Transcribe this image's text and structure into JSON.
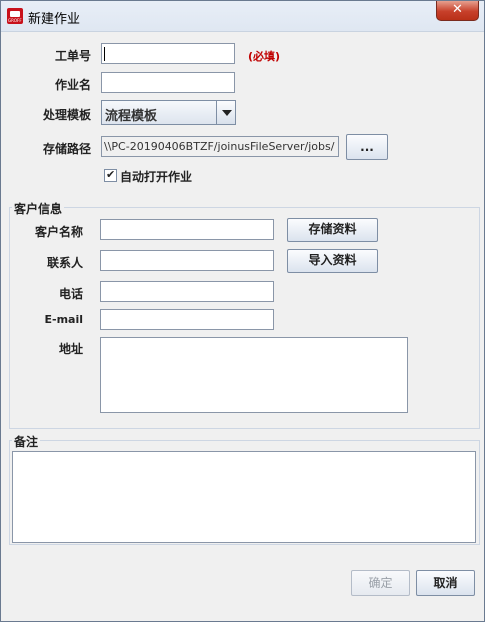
{
  "window": {
    "title": "新建作业",
    "close_symbol": "✕"
  },
  "form": {
    "order_no_label": "工单号",
    "required_hint": "(必填)",
    "job_name_label": "作业名",
    "template_label": "处理模板",
    "template_value": "流程模板",
    "path_label": "存储路径",
    "path_value": "\\\\PC-20190406BTZF/joinusFileServer/jobs/",
    "browse_label": "...",
    "auto_open_label": "自动打开作业",
    "auto_open_checked": true
  },
  "customer": {
    "title": "客户信息",
    "name_label": "客户名称",
    "save_button": "存储资料",
    "contact_label": "联系人",
    "import_button": "导入资料",
    "phone_label": "电话",
    "email_label": "E-mail",
    "address_label": "地址"
  },
  "notes": {
    "title": "备注"
  },
  "footer": {
    "ok_label": "确定",
    "cancel_label": "取消"
  }
}
